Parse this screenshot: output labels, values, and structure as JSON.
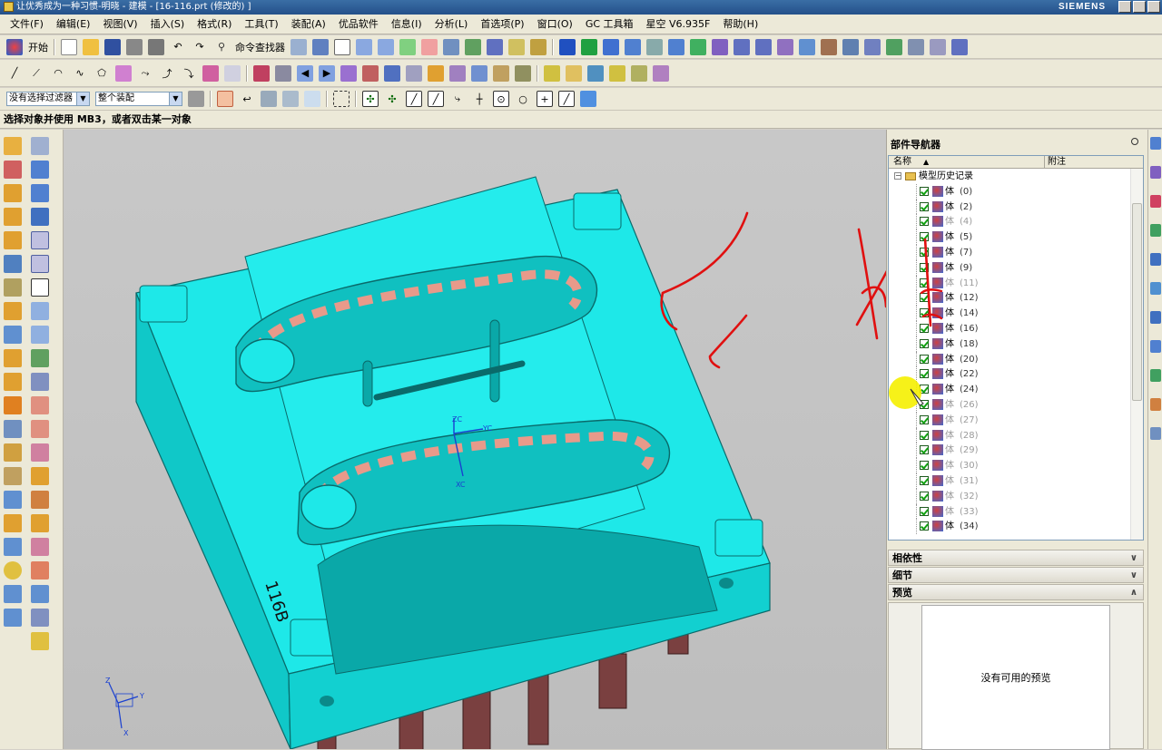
{
  "window": {
    "title": "让优秀成为一种习惯-明晓 - 建模 - [16-116.prt (修改的) ]",
    "brand": "SIEMENS"
  },
  "menu": [
    "文件(F)",
    "编辑(E)",
    "视图(V)",
    "插入(S)",
    "格式(R)",
    "工具(T)",
    "装配(A)",
    "优品软件",
    "信息(I)",
    "分析(L)",
    "首选项(P)",
    "窗口(O)",
    "GC 工具箱",
    "星空 V6.935F",
    "帮助(H)"
  ],
  "toolbar": {
    "start_label": "开始",
    "command_finder_label": "命令查找器"
  },
  "selection": {
    "filter_value": "没有选择过滤器",
    "scope_value": "整个装配"
  },
  "status_prompt": "选择对象并使用 MB3，或者双击某一对象",
  "navigator": {
    "title": "部件导航器",
    "col_name": "名称",
    "col_note": "附注",
    "root_label": "模型历史记录",
    "body_label": "体",
    "rows": [
      {
        "num": "(0)",
        "dim": false
      },
      {
        "num": "(2)",
        "dim": false
      },
      {
        "num": "(4)",
        "dim": true
      },
      {
        "num": "(5)",
        "dim": false
      },
      {
        "num": "(7)",
        "dim": false
      },
      {
        "num": "(9)",
        "dim": false
      },
      {
        "num": "(11)",
        "dim": true
      },
      {
        "num": "(12)",
        "dim": false
      },
      {
        "num": "(14)",
        "dim": false
      },
      {
        "num": "(16)",
        "dim": false
      },
      {
        "num": "(18)",
        "dim": false
      },
      {
        "num": "(20)",
        "dim": false
      },
      {
        "num": "(22)",
        "dim": false
      },
      {
        "num": "(24)",
        "dim": false
      },
      {
        "num": "(26)",
        "dim": true
      },
      {
        "num": "(27)",
        "dim": true
      },
      {
        "num": "(28)",
        "dim": true
      },
      {
        "num": "(29)",
        "dim": true
      },
      {
        "num": "(30)",
        "dim": true
      },
      {
        "num": "(31)",
        "dim": true
      },
      {
        "num": "(32)",
        "dim": true
      },
      {
        "num": "(33)",
        "dim": true
      },
      {
        "num": "(34)",
        "dim": false
      }
    ],
    "panels": {
      "dependency": "相依性",
      "details": "细节",
      "preview": "预览"
    },
    "preview_empty": "没有可用的预览"
  },
  "viewport": {
    "part_label": "116B",
    "axis_zc": "ZC",
    "axis_yc": "YC",
    "axis_xc": "XC",
    "triad_z": "Z",
    "triad_y": "Y",
    "triad_x": "X"
  },
  "colors": {
    "part_body": "#1ee8e8",
    "part_edge": "#0a6a6a",
    "face_highlight": "#e89a8a",
    "pin_color": "#7a4040",
    "annotation_red": "#e01010",
    "cursor_highlight": "#f5f000"
  }
}
